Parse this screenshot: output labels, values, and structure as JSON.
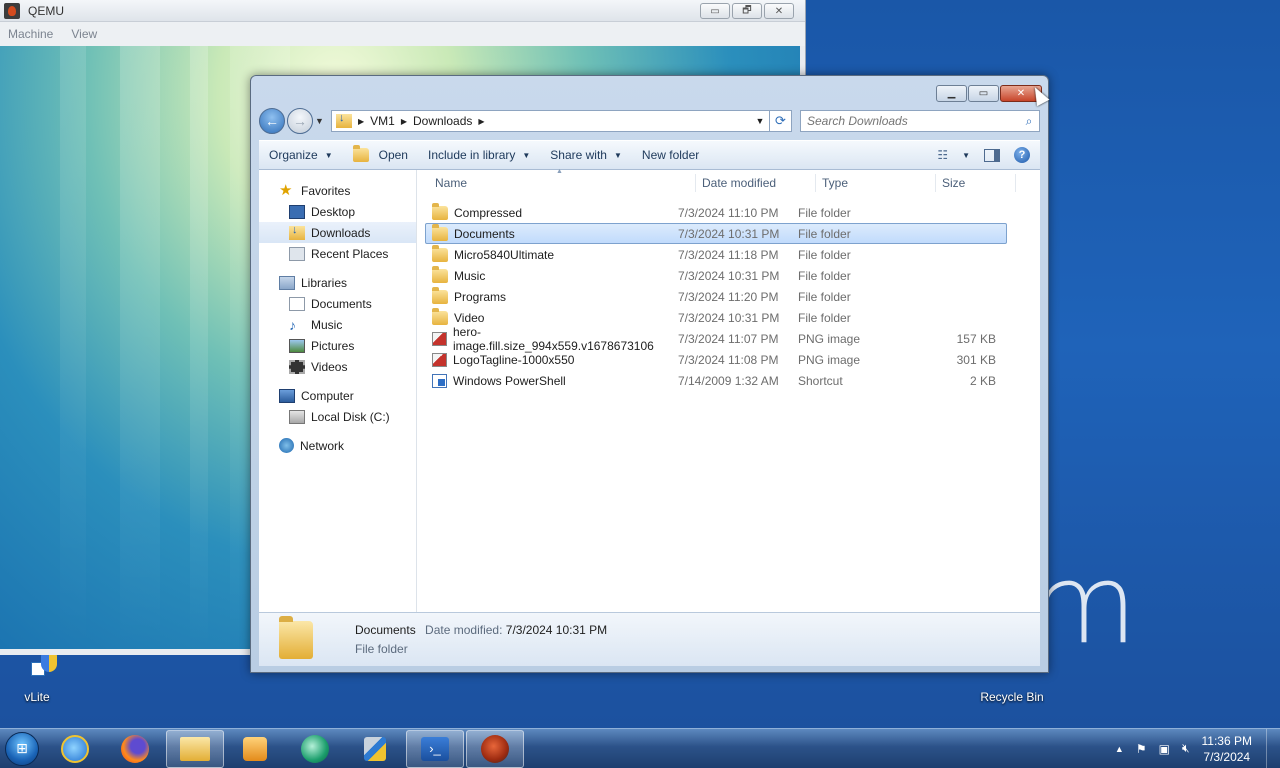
{
  "qemu": {
    "title": "QEMU",
    "menu": [
      "Machine",
      "View"
    ],
    "controls": [
      "▭",
      "🗗",
      "✕"
    ]
  },
  "desktop": {
    "brand_text": "m",
    "icons": {
      "vlite": "vLite",
      "recycle": "Recycle Bin"
    }
  },
  "explorer": {
    "breadcrumb": [
      "VM1",
      "Downloads"
    ],
    "search_placeholder": "Search Downloads",
    "toolbar": {
      "organize": "Organize",
      "open": "Open",
      "include": "Include in library",
      "share": "Share with",
      "new_folder": "New folder"
    },
    "nav": {
      "favorites": "Favorites",
      "desktop": "Desktop",
      "downloads": "Downloads",
      "recent": "Recent Places",
      "libraries": "Libraries",
      "documents": "Documents",
      "music": "Music",
      "pictures": "Pictures",
      "videos": "Videos",
      "computer": "Computer",
      "local_disk": "Local Disk (C:)",
      "network": "Network"
    },
    "columns": {
      "name": "Name",
      "date": "Date modified",
      "type": "Type",
      "size": "Size"
    },
    "files": [
      {
        "name": "Compressed",
        "date": "7/3/2024 11:10 PM",
        "type": "File folder",
        "size": "",
        "icon": "folder-icon"
      },
      {
        "name": "Documents",
        "date": "7/3/2024 10:31 PM",
        "type": "File folder",
        "size": "",
        "icon": "folder-icon"
      },
      {
        "name": "Micro5840Ultimate",
        "date": "7/3/2024 11:18 PM",
        "type": "File folder",
        "size": "",
        "icon": "folder-icon"
      },
      {
        "name": "Music",
        "date": "7/3/2024 10:31 PM",
        "type": "File folder",
        "size": "",
        "icon": "folder-icon"
      },
      {
        "name": "Programs",
        "date": "7/3/2024 11:20 PM",
        "type": "File folder",
        "size": "",
        "icon": "folder-icon"
      },
      {
        "name": "Video",
        "date": "7/3/2024 10:31 PM",
        "type": "File folder",
        "size": "",
        "icon": "folder-icon"
      },
      {
        "name": "hero-image.fill.size_994x559.v1678673106",
        "date": "7/3/2024 11:07 PM",
        "type": "PNG image",
        "size": "157 KB",
        "icon": "png-file-icon"
      },
      {
        "name": "LogoTagline-1000x550",
        "date": "7/3/2024 11:08 PM",
        "type": "PNG image",
        "size": "301 KB",
        "icon": "png-file-icon"
      },
      {
        "name": "Windows PowerShell",
        "date": "7/14/2009 1:32 AM",
        "type": "Shortcut",
        "size": "2 KB",
        "icon": "powershell-shortcut-icon"
      }
    ],
    "selected_index": 1,
    "details": {
      "name": "Documents",
      "date_label": "Date modified:",
      "date_value": "7/3/2024 10:31 PM",
      "type": "File folder"
    }
  },
  "taskbar": {
    "time": "11:36 PM",
    "date": "7/3/2024"
  },
  "colors": {
    "selection": "#c1dbfc",
    "selection_border": "#7da2ce",
    "close_button": "#c7452a",
    "taskbar": "#2c5289"
  }
}
